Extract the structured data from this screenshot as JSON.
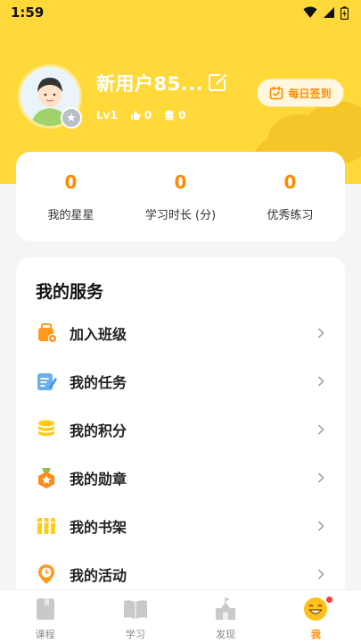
{
  "status_bar": {
    "time": "1:59"
  },
  "profile": {
    "username": "新用户85...",
    "level": "Lv1",
    "likes": "0",
    "coins": "0"
  },
  "signin_label": "每日签到",
  "stats": [
    {
      "value": "0",
      "label": "我的星星"
    },
    {
      "value": "0",
      "label": "学习时长 (分)"
    },
    {
      "value": "0",
      "label": "优秀练习"
    }
  ],
  "services": {
    "title": "我的服务",
    "items": [
      {
        "label": "加入班级",
        "icon": "join-class-icon"
      },
      {
        "label": "我的任务",
        "icon": "task-icon"
      },
      {
        "label": "我的积分",
        "icon": "points-icon"
      },
      {
        "label": "我的勋章",
        "icon": "medal-icon"
      },
      {
        "label": "我的书架",
        "icon": "bookshelf-icon"
      },
      {
        "label": "我的活动",
        "icon": "activity-icon"
      }
    ]
  },
  "tabbar": {
    "tabs": [
      {
        "label": "课程"
      },
      {
        "label": "学习"
      },
      {
        "label": "发现"
      },
      {
        "label": "我"
      }
    ]
  },
  "colors": {
    "brand_yellow": "#ffd83a",
    "accent_orange": "#ff8a00"
  }
}
